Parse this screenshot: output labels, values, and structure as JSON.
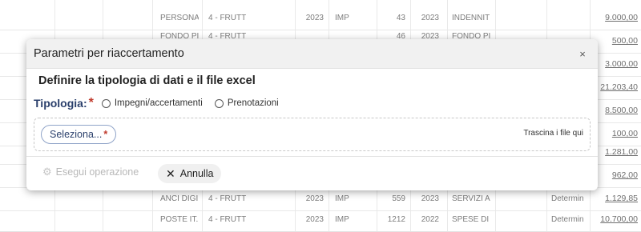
{
  "background_table": {
    "top_row": {
      "c1": "PERSONA",
      "c2": "4 - FRUTT",
      "c3": "2023",
      "c4": "IMP",
      "c5": "43",
      "c6": "2023",
      "c7": "INDENNIT",
      "amount": "9.000,00"
    },
    "second_row_partial": {
      "c1": "FONDO PI",
      "c2": "4 - FRUTT",
      "c5": "46",
      "c6": "2023",
      "c7": "FONDO PI",
      "amount": "500,00"
    },
    "hidden_amounts": [
      "3.000,00",
      "21.203,40",
      "8.500,00",
      "100,00",
      "1.281,00",
      "962,00"
    ],
    "rows_bottom": [
      {
        "c1": "ANCI DIGI",
        "c2": "4 - FRUTT",
        "c3": "2023",
        "c4": "IMP",
        "c5": "559",
        "c6": "2023",
        "c7": "SERVIZI A",
        "c8": "Determin",
        "amount": "1.129,85"
      },
      {
        "c1": "POSTE IT.",
        "c2": "4 - FRUTT",
        "c3": "2023",
        "c4": "IMP",
        "c5": "1212",
        "c6": "2022",
        "c7": "SPESE DI",
        "c8": "Determin",
        "amount": "10.700,00"
      }
    ]
  },
  "dialog": {
    "title": "Parametri per riaccertamento",
    "close_icon": "×",
    "subtitle": "Definire la tipologia di dati e il file excel",
    "tipologia_label": "Tipologia:",
    "required_mark": "*",
    "radio_options": [
      "Impegni/accertamenti",
      "Prenotazioni"
    ],
    "select_button": "Seleziona...",
    "drag_text": "Trascina i file qui",
    "execute_button": "Esegui operazione",
    "cancel_button": "Annulla"
  }
}
